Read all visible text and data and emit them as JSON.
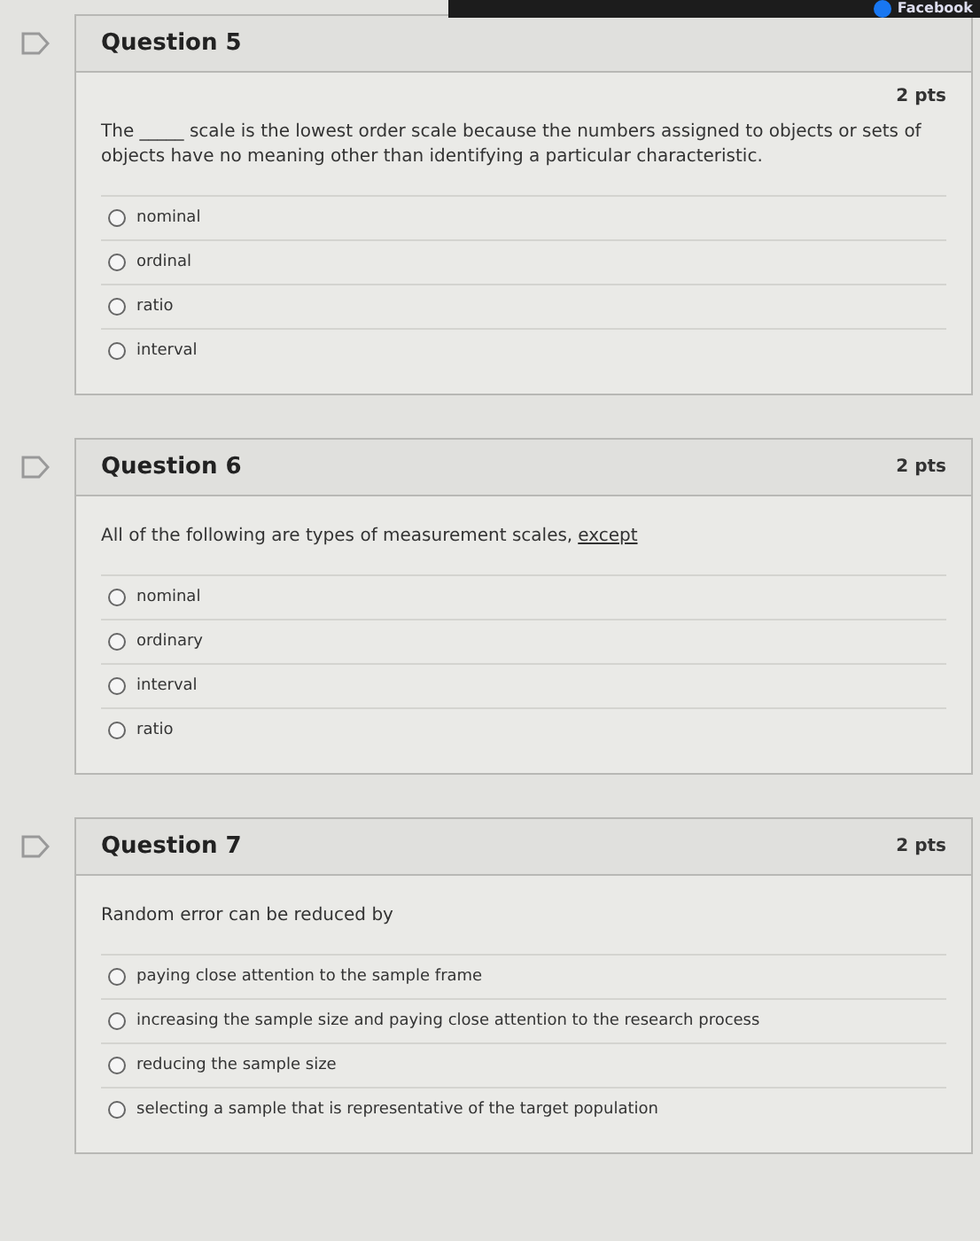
{
  "top_bar": {
    "label": "Facebook"
  },
  "questions": [
    {
      "title": "Question 5",
      "body_points": "2 pts",
      "prompt": "The _____ scale is the lowest order scale because the numbers assigned to objects or sets of objects have no meaning other than identifying a particular characteristic.",
      "options": [
        {
          "label": "nominal",
          "selected": false
        },
        {
          "label": "ordinal",
          "selected": false
        },
        {
          "label": "ratio",
          "selected": false
        },
        {
          "label": "interval",
          "selected": false
        }
      ]
    },
    {
      "title": "Question 6",
      "points": "2 pts",
      "prompt": "All of the following are types of measurement scales,",
      "prompt_underlined": "except",
      "options": [
        {
          "label": "nominal",
          "selected": false
        },
        {
          "label": "ordinary",
          "selected": false
        },
        {
          "label": "interval",
          "selected": false
        },
        {
          "label": "ratio",
          "selected": false
        }
      ]
    },
    {
      "title": "Question 7",
      "points": "2 pts",
      "prompt": "Random error can be reduced by",
      "options": [
        {
          "label": "paying close attention to the sample frame",
          "selected": false
        },
        {
          "label": "increasing the sample size and paying close attention to the research process",
          "selected": false
        },
        {
          "label": "reducing the sample size",
          "selected": false
        },
        {
          "label": "selecting a sample that is representative of the target population",
          "selected": false
        }
      ]
    }
  ]
}
